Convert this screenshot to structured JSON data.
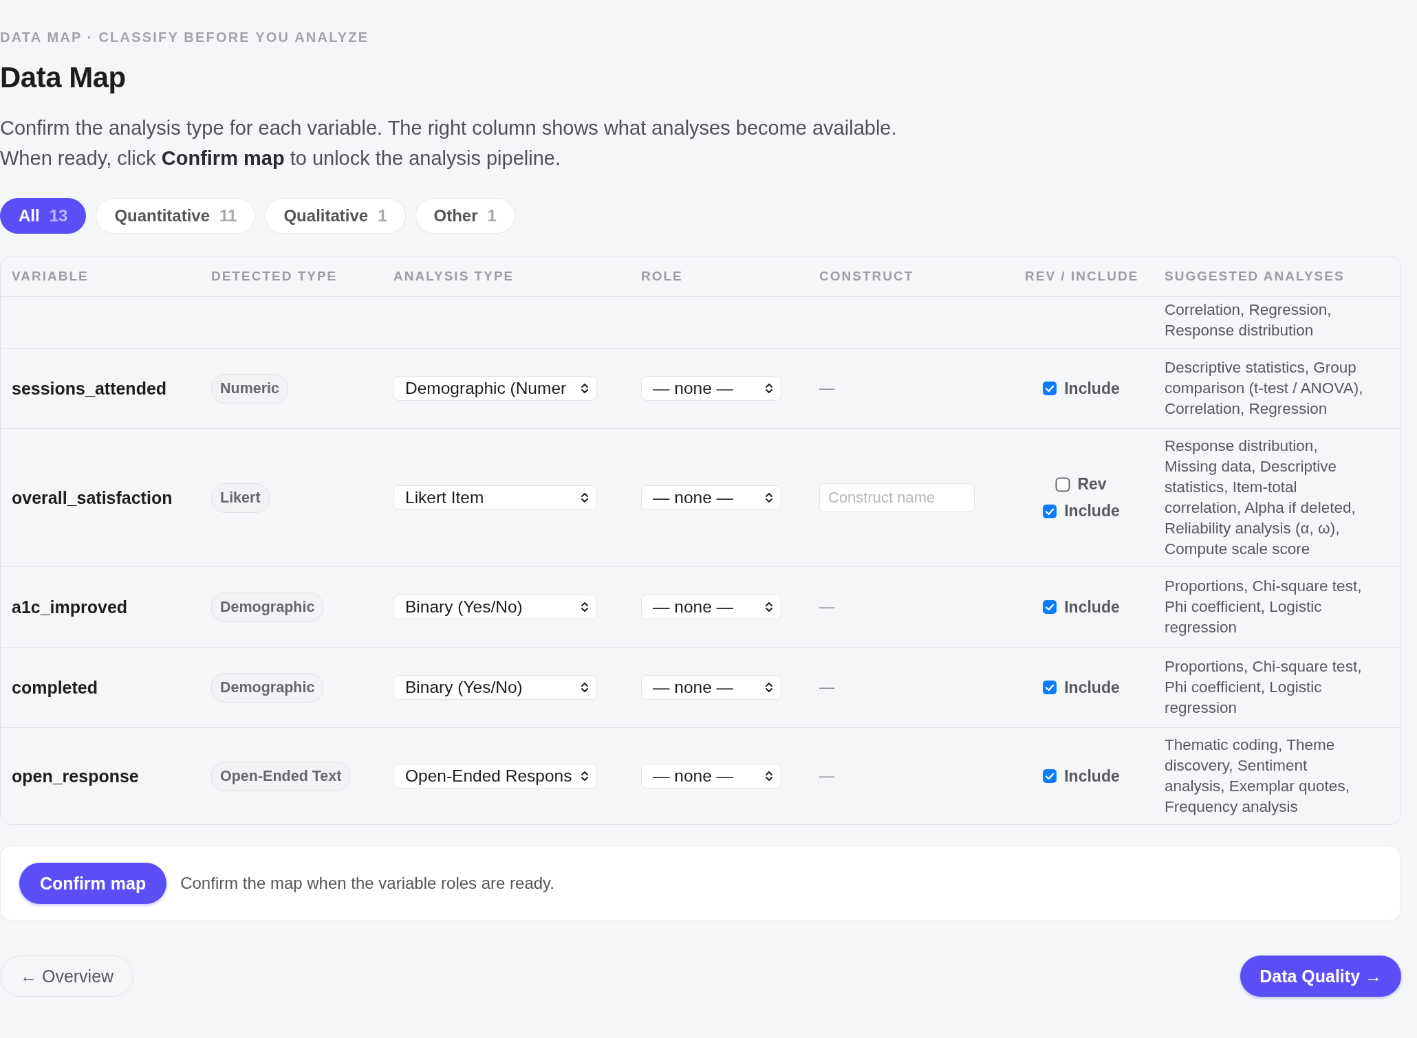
{
  "eyebrow": "DATA MAP · CLASSIFY BEFORE YOU ANALYZE",
  "title": "Data Map",
  "description": [
    "Confirm the analysis type for each variable. The right column shows what analyses become available.",
    "When ready, click **Confirm map** to unlock the analysis pipeline."
  ],
  "filters": [
    {
      "label": "All",
      "count": "13",
      "selected": true
    },
    {
      "label": "Quantitative",
      "count": "11",
      "selected": false
    },
    {
      "label": "Qualitative",
      "count": "1",
      "selected": false
    },
    {
      "label": "Other",
      "count": "1",
      "selected": false
    }
  ],
  "table": {
    "columns": [
      "VARIABLE",
      "DETECTED TYPE",
      "ANALYSIS TYPE",
      "ROLE",
      "CONSTRUCT",
      "REV / INCLUDE",
      "SUGGESTED ANALYSES"
    ],
    "rows": [
      {
        "kind": "partial",
        "analyses": "Correlation, Regression, Response distribution"
      },
      {
        "kind": "full",
        "variable": "sessions_attended",
        "detected": "Numeric",
        "analysis_type": "Demographic (Numer",
        "role": "— none —",
        "construct": {
          "kind": "dash",
          "text": "—"
        },
        "rev": null,
        "include": {
          "label": "Include",
          "checked": true
        },
        "analyses": "Descriptive statistics, Group comparison (t-test / ANOVA), Correlation, Regression"
      },
      {
        "kind": "full",
        "variable": "overall_satisfaction",
        "detected": "Likert",
        "analysis_type": "Likert Item",
        "role": "— none —",
        "construct": {
          "kind": "field",
          "placeholder": "Construct name"
        },
        "rev": {
          "label": "Rev",
          "checked": false
        },
        "include": {
          "label": "Include",
          "checked": true
        },
        "analyses": "Response distribution, Missing data, Descriptive statistics, Item-total correlation, Alpha if deleted, Reliability analysis (α, ω), Compute scale score"
      },
      {
        "kind": "full",
        "variable": "a1c_improved",
        "detected": "Demographic",
        "analysis_type": "Binary (Yes/No)",
        "role": "— none —",
        "construct": {
          "kind": "dash",
          "text": "—"
        },
        "rev": null,
        "include": {
          "label": "Include",
          "checked": true
        },
        "analyses": "Proportions, Chi-square test, Phi coefficient, Logistic regression"
      },
      {
        "kind": "full",
        "variable": "completed",
        "detected": "Demographic",
        "analysis_type": "Binary (Yes/No)",
        "role": "— none —",
        "construct": {
          "kind": "dash",
          "text": "—"
        },
        "rev": null,
        "include": {
          "label": "Include",
          "checked": true
        },
        "analyses": "Proportions, Chi-square test, Phi coefficient, Logistic regression"
      },
      {
        "kind": "full",
        "variable": "open_response",
        "detected": "Open-Ended Text",
        "analysis_type": "Open-Ended Respons",
        "role": "— none —",
        "construct": {
          "kind": "dash",
          "text": "—"
        },
        "rev": null,
        "include": {
          "label": "Include",
          "checked": true
        },
        "analyses": "Thematic coding, Theme discovery, Sentiment analysis, Exemplar quotes, Frequency analysis"
      }
    ]
  },
  "action": {
    "button": "Confirm map",
    "note": "Confirm the map when the variable roles are ready."
  },
  "footer": {
    "back": "← Overview",
    "next": "Data Quality →"
  }
}
